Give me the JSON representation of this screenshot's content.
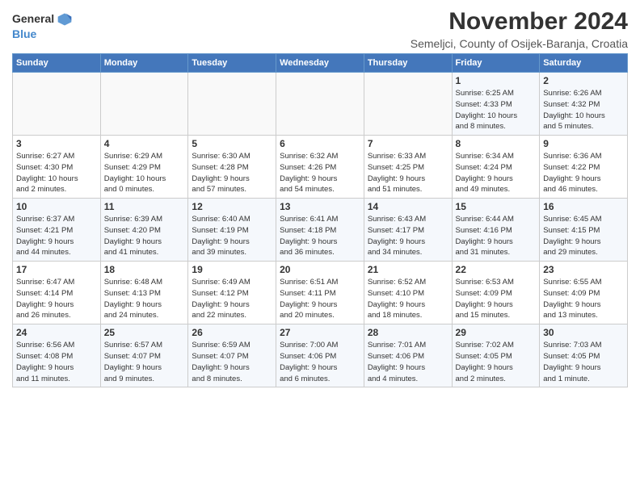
{
  "header": {
    "logo_general": "General",
    "logo_blue": "Blue",
    "month_title": "November 2024",
    "location": "Semeljci, County of Osijek-Baranja, Croatia"
  },
  "weekdays": [
    "Sunday",
    "Monday",
    "Tuesday",
    "Wednesday",
    "Thursday",
    "Friday",
    "Saturday"
  ],
  "weeks": [
    [
      {
        "day": "",
        "info": ""
      },
      {
        "day": "",
        "info": ""
      },
      {
        "day": "",
        "info": ""
      },
      {
        "day": "",
        "info": ""
      },
      {
        "day": "",
        "info": ""
      },
      {
        "day": "1",
        "info": "Sunrise: 6:25 AM\nSunset: 4:33 PM\nDaylight: 10 hours\nand 8 minutes."
      },
      {
        "day": "2",
        "info": "Sunrise: 6:26 AM\nSunset: 4:32 PM\nDaylight: 10 hours\nand 5 minutes."
      }
    ],
    [
      {
        "day": "3",
        "info": "Sunrise: 6:27 AM\nSunset: 4:30 PM\nDaylight: 10 hours\nand 2 minutes."
      },
      {
        "day": "4",
        "info": "Sunrise: 6:29 AM\nSunset: 4:29 PM\nDaylight: 10 hours\nand 0 minutes."
      },
      {
        "day": "5",
        "info": "Sunrise: 6:30 AM\nSunset: 4:28 PM\nDaylight: 9 hours\nand 57 minutes."
      },
      {
        "day": "6",
        "info": "Sunrise: 6:32 AM\nSunset: 4:26 PM\nDaylight: 9 hours\nand 54 minutes."
      },
      {
        "day": "7",
        "info": "Sunrise: 6:33 AM\nSunset: 4:25 PM\nDaylight: 9 hours\nand 51 minutes."
      },
      {
        "day": "8",
        "info": "Sunrise: 6:34 AM\nSunset: 4:24 PM\nDaylight: 9 hours\nand 49 minutes."
      },
      {
        "day": "9",
        "info": "Sunrise: 6:36 AM\nSunset: 4:22 PM\nDaylight: 9 hours\nand 46 minutes."
      }
    ],
    [
      {
        "day": "10",
        "info": "Sunrise: 6:37 AM\nSunset: 4:21 PM\nDaylight: 9 hours\nand 44 minutes."
      },
      {
        "day": "11",
        "info": "Sunrise: 6:39 AM\nSunset: 4:20 PM\nDaylight: 9 hours\nand 41 minutes."
      },
      {
        "day": "12",
        "info": "Sunrise: 6:40 AM\nSunset: 4:19 PM\nDaylight: 9 hours\nand 39 minutes."
      },
      {
        "day": "13",
        "info": "Sunrise: 6:41 AM\nSunset: 4:18 PM\nDaylight: 9 hours\nand 36 minutes."
      },
      {
        "day": "14",
        "info": "Sunrise: 6:43 AM\nSunset: 4:17 PM\nDaylight: 9 hours\nand 34 minutes."
      },
      {
        "day": "15",
        "info": "Sunrise: 6:44 AM\nSunset: 4:16 PM\nDaylight: 9 hours\nand 31 minutes."
      },
      {
        "day": "16",
        "info": "Sunrise: 6:45 AM\nSunset: 4:15 PM\nDaylight: 9 hours\nand 29 minutes."
      }
    ],
    [
      {
        "day": "17",
        "info": "Sunrise: 6:47 AM\nSunset: 4:14 PM\nDaylight: 9 hours\nand 26 minutes."
      },
      {
        "day": "18",
        "info": "Sunrise: 6:48 AM\nSunset: 4:13 PM\nDaylight: 9 hours\nand 24 minutes."
      },
      {
        "day": "19",
        "info": "Sunrise: 6:49 AM\nSunset: 4:12 PM\nDaylight: 9 hours\nand 22 minutes."
      },
      {
        "day": "20",
        "info": "Sunrise: 6:51 AM\nSunset: 4:11 PM\nDaylight: 9 hours\nand 20 minutes."
      },
      {
        "day": "21",
        "info": "Sunrise: 6:52 AM\nSunset: 4:10 PM\nDaylight: 9 hours\nand 18 minutes."
      },
      {
        "day": "22",
        "info": "Sunrise: 6:53 AM\nSunset: 4:09 PM\nDaylight: 9 hours\nand 15 minutes."
      },
      {
        "day": "23",
        "info": "Sunrise: 6:55 AM\nSunset: 4:09 PM\nDaylight: 9 hours\nand 13 minutes."
      }
    ],
    [
      {
        "day": "24",
        "info": "Sunrise: 6:56 AM\nSunset: 4:08 PM\nDaylight: 9 hours\nand 11 minutes."
      },
      {
        "day": "25",
        "info": "Sunrise: 6:57 AM\nSunset: 4:07 PM\nDaylight: 9 hours\nand 9 minutes."
      },
      {
        "day": "26",
        "info": "Sunrise: 6:59 AM\nSunset: 4:07 PM\nDaylight: 9 hours\nand 8 minutes."
      },
      {
        "day": "27",
        "info": "Sunrise: 7:00 AM\nSunset: 4:06 PM\nDaylight: 9 hours\nand 6 minutes."
      },
      {
        "day": "28",
        "info": "Sunrise: 7:01 AM\nSunset: 4:06 PM\nDaylight: 9 hours\nand 4 minutes."
      },
      {
        "day": "29",
        "info": "Sunrise: 7:02 AM\nSunset: 4:05 PM\nDaylight: 9 hours\nand 2 minutes."
      },
      {
        "day": "30",
        "info": "Sunrise: 7:03 AM\nSunset: 4:05 PM\nDaylight: 9 hours\nand 1 minute."
      }
    ]
  ]
}
